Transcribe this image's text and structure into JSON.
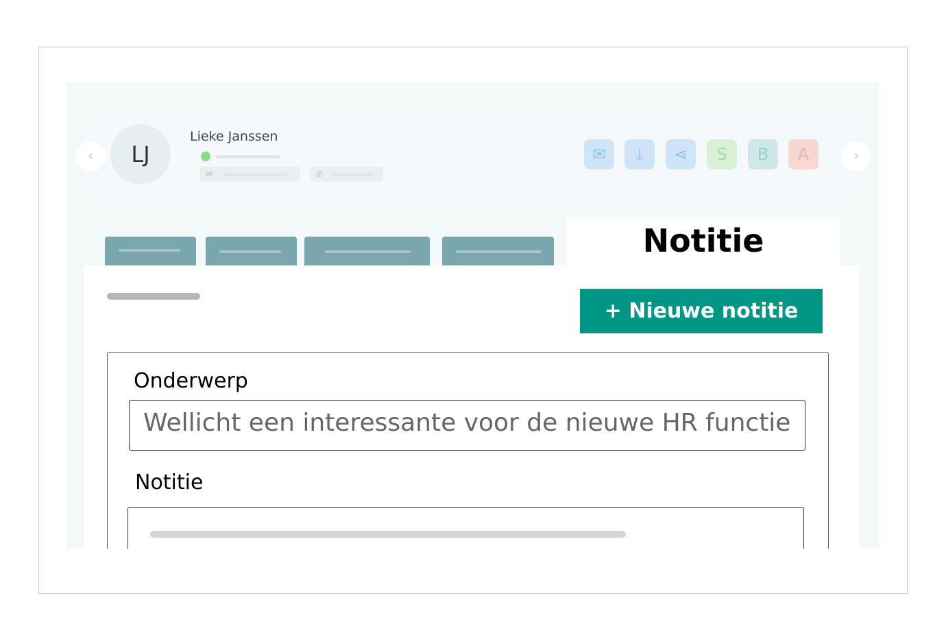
{
  "contact": {
    "initials": "LJ",
    "name": "Lieke Janssen",
    "status_color": "#8cd98a"
  },
  "header": {
    "prev_icon": "chevron-left-icon",
    "next_icon": "chevron-right-icon",
    "prev_glyph": "‹",
    "next_glyph": "›",
    "actions": [
      {
        "name": "mail",
        "glyph": "✉",
        "bg": "#cfe4f7",
        "fg": "#8fc3ef"
      },
      {
        "name": "download",
        "glyph": "⤓",
        "bg": "#cfe4f7",
        "fg": "#8fc3ef"
      },
      {
        "name": "share",
        "glyph": "⋖",
        "bg": "#cfe4f7",
        "fg": "#8fc3ef"
      },
      {
        "name": "S",
        "glyph": "S",
        "bg": "#d8f1d4",
        "fg": "#a6df9f"
      },
      {
        "name": "B",
        "glyph": "B",
        "bg": "#cde8e6",
        "fg": "#98d2cc"
      },
      {
        "name": "A",
        "glyph": "A",
        "bg": "#f6d7d2",
        "fg": "#f0b6ad"
      }
    ]
  },
  "tabs": {
    "active_label": "Notitie"
  },
  "panel": {
    "new_button_label": "+ Nieuwe notitie",
    "brand_color": "#009686"
  },
  "form": {
    "subject_label": "Onderwerp",
    "subject_value": "Wellicht een interessante voor de nieuwe HR functie",
    "note_label": "Notitie"
  }
}
